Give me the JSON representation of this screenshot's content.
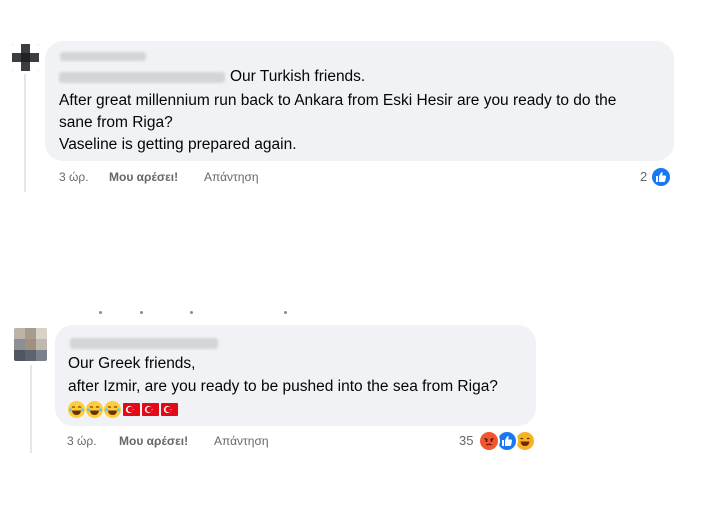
{
  "comments": [
    {
      "text_inline": "Our Turkish friends.",
      "lines": [
        "After great millennium run back to Ankara from Eski Hesir are you ready to do the",
        "sane from Riga?",
        "Vaseline is getting prepared again."
      ],
      "time": "3 ώρ.",
      "like_label": "Μου αρέσει!",
      "reply_label": "Απάντηση",
      "reaction_count": "2",
      "reactions": [
        "like-icon"
      ]
    },
    {
      "lines": [
        "Our Greek friends,",
        "after Izmir, are you ready to be pushed into the sea from Riga?"
      ],
      "emojis": [
        "laughing-face-icon",
        "laughing-face-icon",
        "laughing-face-icon",
        "turkey-flag-icon",
        "turkey-flag-icon",
        "turkey-flag-icon"
      ],
      "time": "3 ώρ.",
      "like_label": "Μου αρέσει!",
      "reply_label": "Απάντηση",
      "reaction_count": "35",
      "reactions": [
        "angry-icon",
        "like-icon",
        "laughing-icon"
      ]
    }
  ],
  "colors": {
    "bubble": "#f0f2f5",
    "like_blue": "#1877f2",
    "angry": "#f0562f",
    "haha": "#f7b125",
    "flag_red": "#e30a17"
  }
}
